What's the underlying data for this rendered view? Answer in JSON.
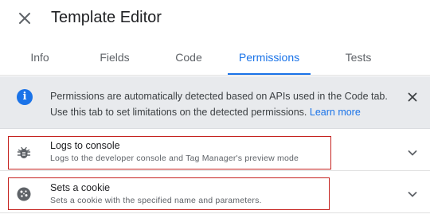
{
  "header": {
    "title": "Template Editor"
  },
  "tabs": [
    {
      "label": "Info"
    },
    {
      "label": "Fields"
    },
    {
      "label": "Code"
    },
    {
      "label": "Permissions"
    },
    {
      "label": "Tests"
    }
  ],
  "active_tab": "Permissions",
  "info": {
    "line1": "Permissions are automatically detected based on APIs used in the Code tab.",
    "line2": "Use this tab to set limitations on the detected permissions.",
    "link": "Learn more"
  },
  "permissions": [
    {
      "title": "Logs to console",
      "description": "Logs to the developer console and Tag Manager's preview mode",
      "icon": "bug-icon"
    },
    {
      "title": "Sets a cookie",
      "description": "Sets a cookie with the specified name and parameters.",
      "icon": "cookie-icon"
    }
  ],
  "colors": {
    "accent": "#1a73e8",
    "highlight_outline": "#c5221f",
    "banner_bg": "#e8eaed"
  }
}
